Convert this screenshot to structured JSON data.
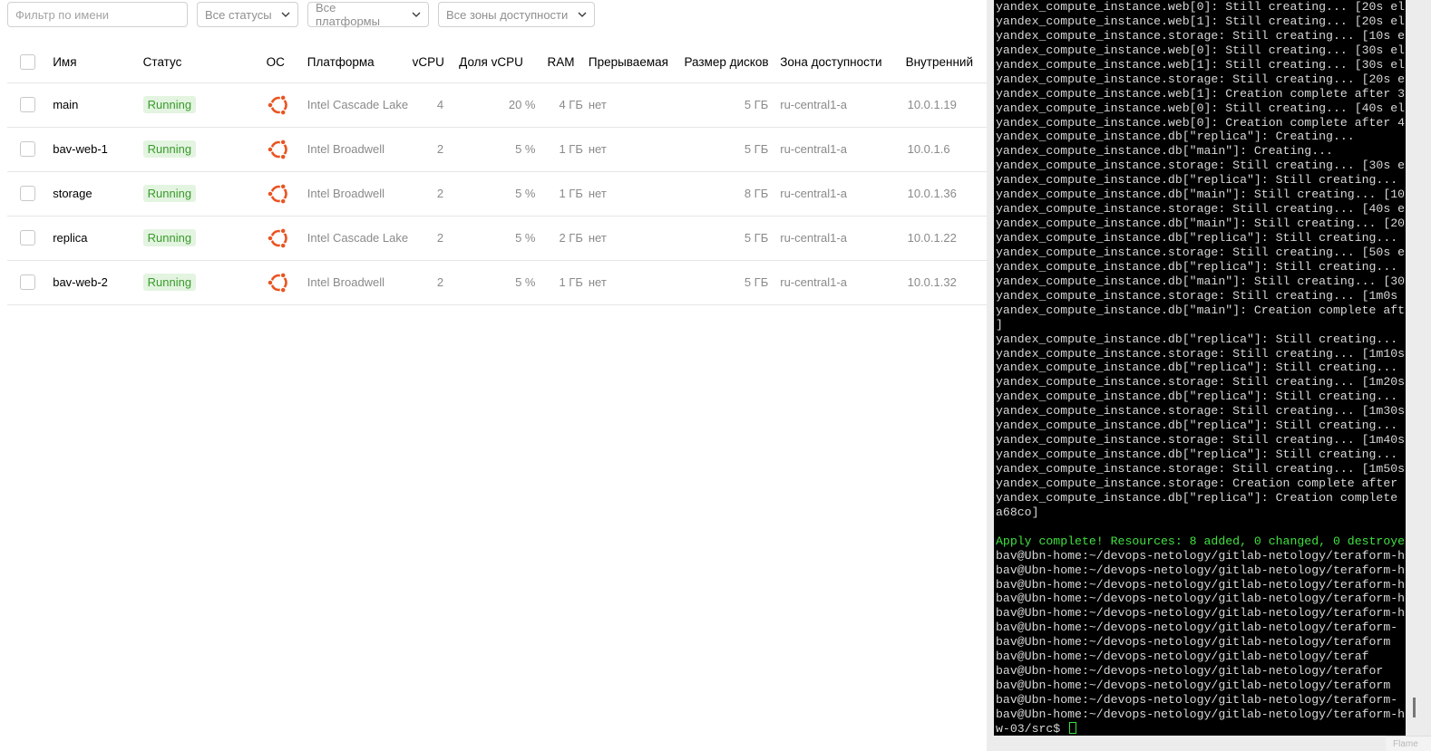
{
  "filters": {
    "name_placeholder": "Фильтр по имени",
    "status": "Все статусы",
    "platform": "Все платформы",
    "zone": "Все зоны доступности"
  },
  "table": {
    "headers": {
      "name": "Имя",
      "status": "Статус",
      "os": "ОС",
      "platform": "Платформа",
      "vcpu": "vCPU",
      "vcpu_share": "Доля vCPU",
      "ram": "RAM",
      "preemptible": "Прерываемая",
      "disk": "Размер дисков",
      "zone": "Зона доступности",
      "internal_ip": "Внутренний"
    },
    "os_icon": "ubuntu-logo",
    "rows": [
      {
        "name": "main",
        "status": "Running",
        "platform": "Intel Cascade Lake",
        "vcpu": "4",
        "vcpu_share": "20 %",
        "ram": "4 ГБ",
        "preemptible": "нет",
        "disk": "5 ГБ",
        "zone": "ru-central1-a",
        "ip": "10.0.1.19"
      },
      {
        "name": "bav-web-1",
        "status": "Running",
        "platform": "Intel Broadwell",
        "vcpu": "2",
        "vcpu_share": "5 %",
        "ram": "1 ГБ",
        "preemptible": "нет",
        "disk": "5 ГБ",
        "zone": "ru-central1-a",
        "ip": "10.0.1.6"
      },
      {
        "name": "storage",
        "status": "Running",
        "platform": "Intel Broadwell",
        "vcpu": "2",
        "vcpu_share": "5 %",
        "ram": "1 ГБ",
        "preemptible": "нет",
        "disk": "8 ГБ",
        "zone": "ru-central1-a",
        "ip": "10.0.1.36"
      },
      {
        "name": "replica",
        "status": "Running",
        "platform": "Intel Cascade Lake",
        "vcpu": "2",
        "vcpu_share": "5 %",
        "ram": "2 ГБ",
        "preemptible": "нет",
        "disk": "5 ГБ",
        "zone": "ru-central1-a",
        "ip": "10.0.1.22"
      },
      {
        "name": "bav-web-2",
        "status": "Running",
        "platform": "Intel Broadwell",
        "vcpu": "2",
        "vcpu_share": "5 %",
        "ram": "1 ГБ",
        "preemptible": "нет",
        "disk": "5 ГБ",
        "zone": "ru-central1-a",
        "ip": "10.0.1.32"
      }
    ]
  },
  "colors": {
    "running_badge_bg": "#e3f4e0",
    "running_badge_text": "#3a9a2c",
    "ubuntu_orange": "#e95420",
    "terminal_bg": "#000000",
    "terminal_green": "#3fe23f"
  },
  "terminal": {
    "lines": [
      {
        "text": "yandex_compute_instance.web[0]: Still creating... [20s el"
      },
      {
        "text": "yandex_compute_instance.web[1]: Still creating... [20s el"
      },
      {
        "text": "yandex_compute_instance.storage: Still creating... [10s e"
      },
      {
        "text": "yandex_compute_instance.web[0]: Still creating... [30s el"
      },
      {
        "text": "yandex_compute_instance.web[1]: Still creating... [30s el"
      },
      {
        "text": "yandex_compute_instance.storage: Still creating... [20s e"
      },
      {
        "text": "yandex_compute_instance.web[1]: Creation complete after 3"
      },
      {
        "text": "yandex_compute_instance.web[0]: Still creating... [40s el"
      },
      {
        "text": "yandex_compute_instance.web[0]: Creation complete after 4"
      },
      {
        "text": "yandex_compute_instance.db[\"replica\"]: Creating..."
      },
      {
        "text": "yandex_compute_instance.db[\"main\"]: Creating..."
      },
      {
        "text": "yandex_compute_instance.storage: Still creating... [30s e"
      },
      {
        "text": "yandex_compute_instance.db[\"replica\"]: Still creating..."
      },
      {
        "text": "yandex_compute_instance.db[\"main\"]: Still creating... [10"
      },
      {
        "text": "yandex_compute_instance.storage: Still creating... [40s e"
      },
      {
        "text": "yandex_compute_instance.db[\"main\"]: Still creating... [20"
      },
      {
        "text": "yandex_compute_instance.db[\"replica\"]: Still creating..."
      },
      {
        "text": "yandex_compute_instance.storage: Still creating... [50s e"
      },
      {
        "text": "yandex_compute_instance.db[\"replica\"]: Still creating..."
      },
      {
        "text": "yandex_compute_instance.db[\"main\"]: Still creating... [30"
      },
      {
        "text": "yandex_compute_instance.storage: Still creating... [1m0s"
      },
      {
        "text": "yandex_compute_instance.db[\"main\"]: Creation complete aft"
      },
      {
        "text": "]"
      },
      {
        "text": "yandex_compute_instance.db[\"replica\"]: Still creating..."
      },
      {
        "text": "yandex_compute_instance.storage: Still creating... [1m10s"
      },
      {
        "text": "yandex_compute_instance.db[\"replica\"]: Still creating..."
      },
      {
        "text": "yandex_compute_instance.storage: Still creating... [1m20s"
      },
      {
        "text": "yandex_compute_instance.db[\"replica\"]: Still creating..."
      },
      {
        "text": "yandex_compute_instance.storage: Still creating... [1m30s"
      },
      {
        "text": "yandex_compute_instance.db[\"replica\"]: Still creating..."
      },
      {
        "text": "yandex_compute_instance.storage: Still creating... [1m40s"
      },
      {
        "text": "yandex_compute_instance.db[\"replica\"]: Still creating..."
      },
      {
        "text": "yandex_compute_instance.storage: Still creating... [1m50s"
      },
      {
        "text": "yandex_compute_instance.storage: Creation complete after"
      },
      {
        "text": "yandex_compute_instance.db[\"replica\"]: Creation complete"
      },
      {
        "text": "a68co]"
      },
      {
        "text": ""
      },
      {
        "text": "Apply complete! Resources: 8 added, 0 changed, 0 destroye",
        "green": true
      },
      {
        "text": "bav@Ubn-home:~/devops-netology/gitlab-netology/teraform-h"
      },
      {
        "text": "bav@Ubn-home:~/devops-netology/gitlab-netology/teraform-h"
      },
      {
        "text": "bav@Ubn-home:~/devops-netology/gitlab-netology/teraform-h"
      },
      {
        "text": "bav@Ubn-home:~/devops-netology/gitlab-netology/teraform-h"
      },
      {
        "text": "bav@Ubn-home:~/devops-netology/gitlab-netology/teraform-h"
      },
      {
        "text": "bav@Ubn-home:~/devops-netology/gitlab-netology/teraform-"
      },
      {
        "text": "bav@Ubn-home:~/devops-netology/gitlab-netology/teraform"
      },
      {
        "text": "bav@Ubn-home:~/devops-netology/gitlab-netology/teraf"
      },
      {
        "text": "bav@Ubn-home:~/devops-netology/gitlab-netology/terafor"
      },
      {
        "text": "bav@Ubn-home:~/devops-netology/gitlab-netology/teraform"
      },
      {
        "text": "bav@Ubn-home:~/devops-netology/gitlab-netology/teraform-"
      },
      {
        "text": "bav@Ubn-home:~/devops-netology/gitlab-netology/teraform-h"
      }
    ],
    "prompt": "w-03/src$ ",
    "status_fragment": "Flame"
  }
}
